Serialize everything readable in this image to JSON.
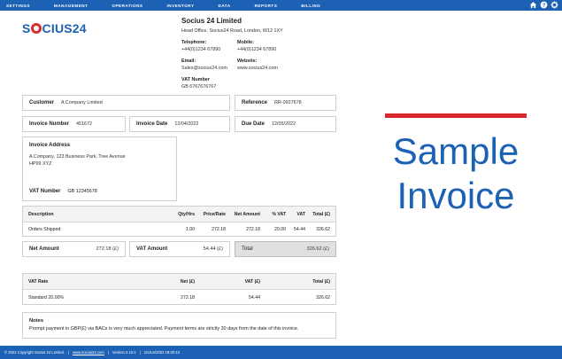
{
  "nav": {
    "items": [
      "SETTINGS",
      "MANAGEMENT",
      "OPERATIONS",
      "INVENTORY",
      "DATA",
      "REPORTS",
      "BILLING"
    ]
  },
  "logo": {
    "text_before": "S",
    "text_after": "CIUS24"
  },
  "company": {
    "name": "Socius 24 Limited",
    "address": "Head Office, Socius24 Road, London, W12 1XY",
    "telephone_label": "Telephone:",
    "telephone": "+44(0)1234 67890",
    "mobile_label": "Mobile:",
    "mobile": "+44(0)1234 67890",
    "email_label": "Email:",
    "email": "Sales@socius24.com",
    "website_label": "Website:",
    "website": "www.socius24.com",
    "vat_label": "VAT Number",
    "vat": "GB 6767676767"
  },
  "fields": {
    "customer_label": "Customer",
    "customer": "A Company Limited",
    "reference_label": "Reference",
    "reference": "RR-0927678",
    "invoice_number_label": "Invoice Number",
    "invoice_number": "451672",
    "invoice_date_label": "Invoice Date",
    "invoice_date": "12/04/2022",
    "due_date_label": "Due Date",
    "due_date": "12/05/2022"
  },
  "invoice_address": {
    "label": "Invoice Address",
    "line1": "A Company, 123 Business Park, Tree Avenue",
    "line2": "HP99 XYZ",
    "vat_label": "VAT Number",
    "vat": "GB 12345678"
  },
  "items": {
    "headers": {
      "description": "Description",
      "qty": "Qty/Hrs",
      "price": "Price/Rate",
      "net": "Net Amount",
      "vat_pct": "% VAT",
      "vat": "VAT",
      "total": "Total (£)"
    },
    "rows": [
      {
        "description": "Orders Shipped",
        "qty": "1.00",
        "price": "272.18",
        "net": "272.18",
        "vat_pct": "20.00",
        "vat": "54.44",
        "total": "326.62"
      }
    ]
  },
  "totals": {
    "net_label": "Net Amount",
    "net": "272.18  (£)",
    "vat_label": "VAT Amount",
    "vat": "54.44  (£)",
    "total_label": "Total",
    "total": "326.62  (£)"
  },
  "vat_summary": {
    "headers": {
      "rate": "VAT Rate",
      "net": "Net (£)",
      "vat": "VAT (£)",
      "total": "Total (£)"
    },
    "rows": [
      {
        "rate": "Standard 20.00%",
        "net": "272.18",
        "vat": "54.44",
        "total": "326.62"
      }
    ]
  },
  "notes": {
    "label": "Notes",
    "text": "Prompt payment in GBP(£) via BACs is very much appreciated. Payment terms are strictly 30 days from the date of this invoice."
  },
  "footer": {
    "copyright": "© 2022 Copyright Socius 24 Limited.",
    "sep": "|",
    "site": "www.socius24.com",
    "version": "Version 2.10.0",
    "datetime": "11/Jun/2022 18:30:43"
  },
  "overlay": {
    "line1": "Sample",
    "line2": "Invoice"
  },
  "colors": {
    "brand_blue": "#1d61b4",
    "accent_red": "#d9272e"
  },
  "icons": [
    "home-icon",
    "help-icon",
    "settings-icon"
  ]
}
